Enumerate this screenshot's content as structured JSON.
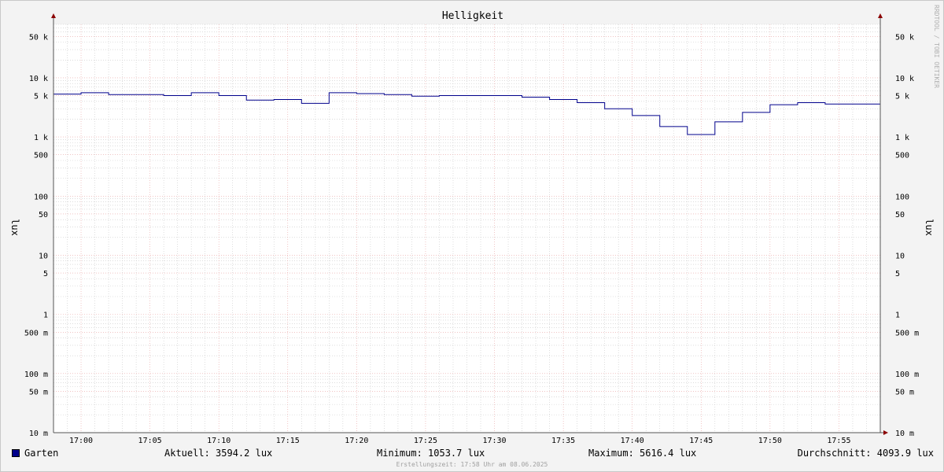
{
  "chart_data": {
    "type": "line",
    "title": "Helligkeit",
    "ylabel": "lux",
    "y_scale": "log",
    "ylim": [
      0.01,
      80000
    ],
    "y_ticks": [
      {
        "v": 50000,
        "label": "50 k"
      },
      {
        "v": 10000,
        "label": "10 k"
      },
      {
        "v": 5000,
        "label": "5 k"
      },
      {
        "v": 1000,
        "label": "1 k"
      },
      {
        "v": 500,
        "label": "500"
      },
      {
        "v": 100,
        "label": "100"
      },
      {
        "v": 50,
        "label": "50"
      },
      {
        "v": 10,
        "label": "10"
      },
      {
        "v": 5,
        "label": "5"
      },
      {
        "v": 1,
        "label": "1"
      },
      {
        "v": 0.5,
        "label": "500 m"
      },
      {
        "v": 0.1,
        "label": "100 m"
      },
      {
        "v": 0.05,
        "label": "50 m"
      },
      {
        "v": 0.01,
        "label": "10 m"
      }
    ],
    "xlim": [
      "16:58",
      "17:58"
    ],
    "x_ticks": [
      "17:00",
      "17:05",
      "17:10",
      "17:15",
      "17:20",
      "17:25",
      "17:30",
      "17:35",
      "17:40",
      "17:45",
      "17:50",
      "17:55"
    ],
    "grid": true,
    "series": [
      {
        "name": "Garten",
        "color": "#00008b",
        "step": true,
        "x": [
          "16:58",
          "17:00",
          "17:02",
          "17:04",
          "17:06",
          "17:08",
          "17:10",
          "17:12",
          "17:14",
          "17:16",
          "17:18",
          "17:20",
          "17:22",
          "17:24",
          "17:26",
          "17:28",
          "17:30",
          "17:32",
          "17:34",
          "17:36",
          "17:38",
          "17:40",
          "17:42",
          "17:44",
          "17:46",
          "17:48",
          "17:50",
          "17:52",
          "17:54",
          "17:56",
          "17:58"
        ],
        "values": [
          5300,
          5600,
          5200,
          5200,
          5000,
          5600,
          5000,
          4200,
          4300,
          3700,
          5600,
          5400,
          5200,
          4900,
          5000,
          5000,
          5000,
          4700,
          4300,
          3800,
          3000,
          2300,
          1500,
          1100,
          1800,
          2600,
          3500,
          3800,
          3600,
          3600,
          3600
        ]
      }
    ]
  },
  "legend": {
    "name": "Garten",
    "aktuell": "Aktuell: 3594.2 lux",
    "minimum": "Minimum: 1053.7 lux",
    "maximum": "Maximum: 5616.4 lux",
    "durchschnitt": "Durchschnitt: 4093.9 lux"
  },
  "watermark": "RRDTOOL / TOBI OETIKER",
  "footer": "Erstellungszeit: 17:58 Uhr am 08.06.2025",
  "colors": {
    "line": "#00008b",
    "major_grid": "#e8a0a0",
    "minor_grid": "#c8c8c8",
    "arrow": "#8b0000"
  }
}
